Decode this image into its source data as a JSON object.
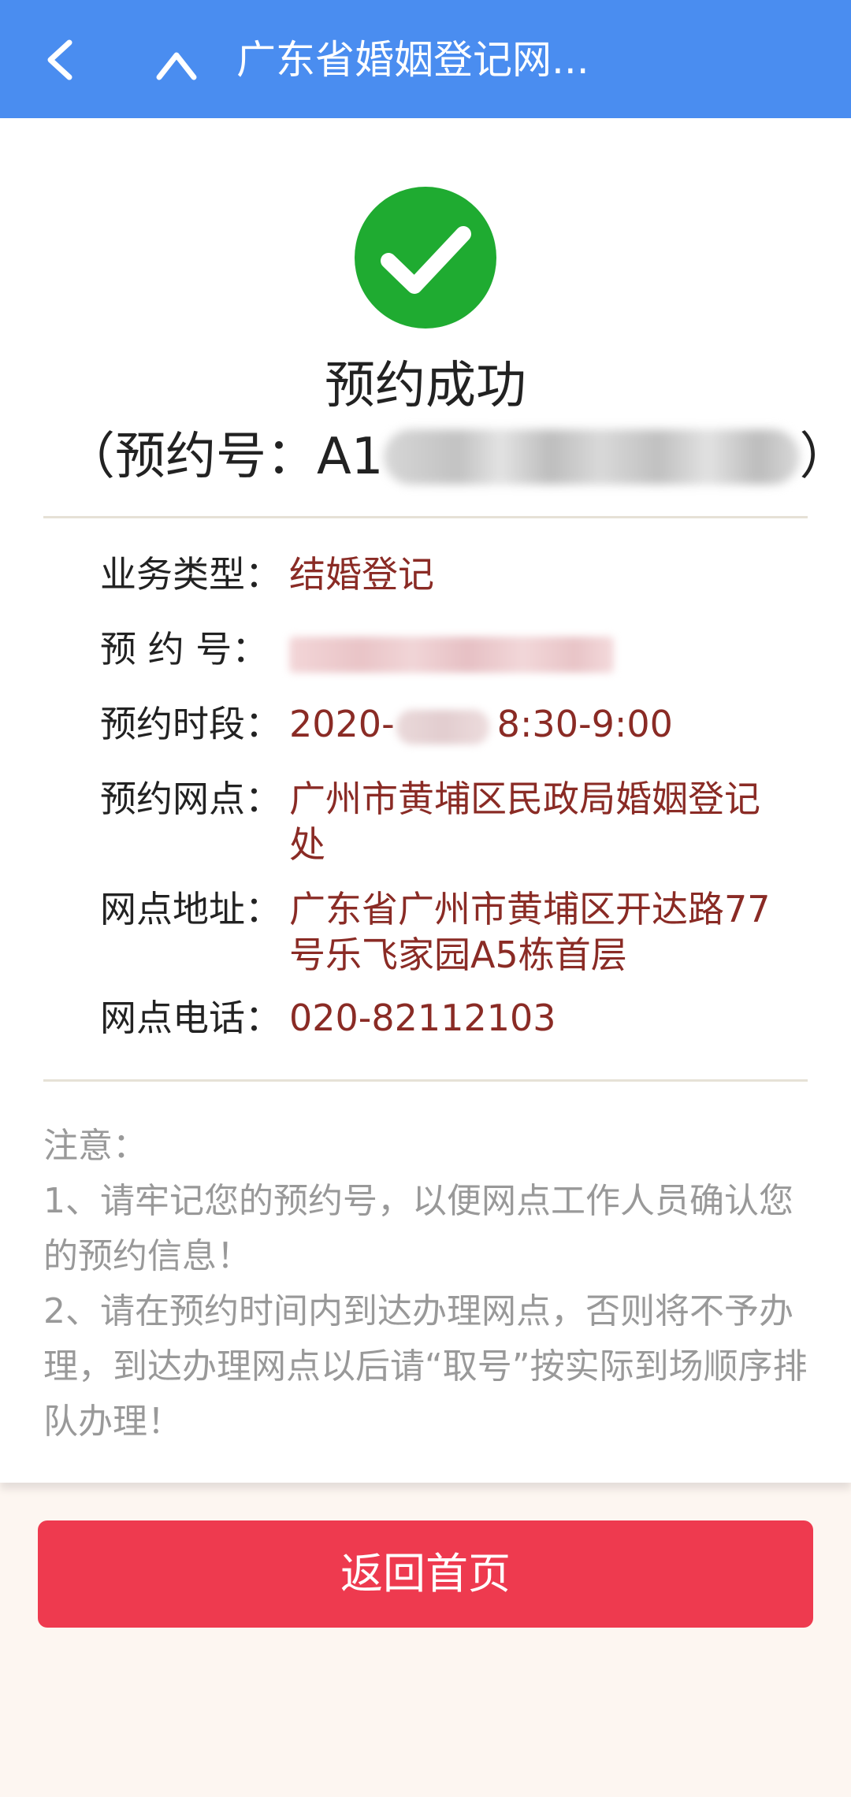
{
  "header": {
    "title": "广东省婚姻登记网...",
    "back_icon": "back-chevron-icon",
    "collapse_icon": "chevron-up-icon"
  },
  "result": {
    "status_icon": "check-circle-icon",
    "title": "预约成功",
    "booking_prefix": "（预约号：A1",
    "booking_suffix": "）"
  },
  "details": {
    "business_type": {
      "label": "业务类型：",
      "value": "结婚登记"
    },
    "booking_number": {
      "label": "预 约 号："
    },
    "time_slot": {
      "label": "预约时段：",
      "value_prefix": "2020-",
      "value_suffix": "8:30-9:00"
    },
    "office": {
      "label": "预约网点：",
      "value": "广州市黄埔区民政局婚姻登记处"
    },
    "address": {
      "label": "网点地址：",
      "value": "广东省广州市黄埔区开达路77号乐飞家园A5栋首层"
    },
    "phone": {
      "label": "网点电话：",
      "value": "020-82112103"
    }
  },
  "notes": {
    "title": "注意：",
    "item1": "1、请牢记您的预约号，以便网点工作人员确认您的预约信息！",
    "item2": "2、请在预约时间内到达办理网点，否则将不予办理，到达办理网点以后请“取号”按实际到场顺序排队办理！"
  },
  "actions": {
    "home_button": "返回首页"
  },
  "colors": {
    "header_bg": "#4a8df0",
    "success_green": "#1fab31",
    "value_red": "#8a2b25",
    "button_red": "#ee3a4f",
    "note_gray": "#999999"
  }
}
